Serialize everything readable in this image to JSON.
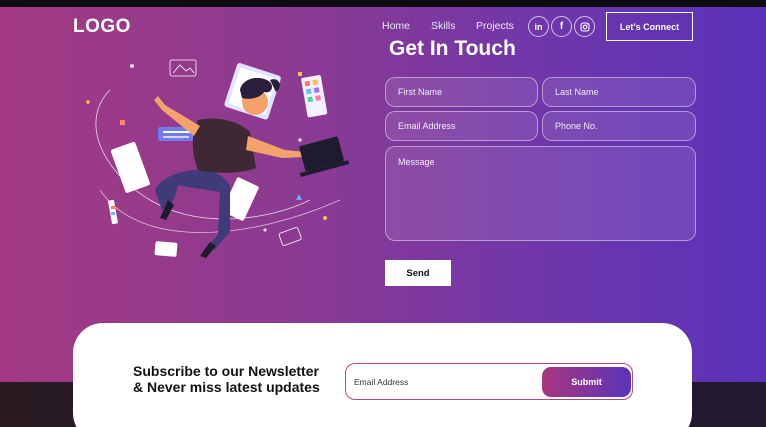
{
  "colors": {
    "hero_gradient_start": "#a33a83",
    "hero_gradient_end": "#5a32b8",
    "white": "#ffffff",
    "submit_gradient_start": "#a8367f",
    "submit_gradient_end": "#5a34b8"
  },
  "header": {
    "logo": "LOGO",
    "nav": [
      {
        "label": "Home"
      },
      {
        "label": "Skills"
      },
      {
        "label": "Projects"
      }
    ],
    "social": [
      {
        "icon": "linkedin-icon",
        "glyph": "in"
      },
      {
        "icon": "facebook-icon",
        "glyph": "f"
      },
      {
        "icon": "instagram-icon",
        "glyph": ""
      }
    ],
    "connect_label": "Let’s Connect"
  },
  "contact": {
    "title": "Get In Touch",
    "first_name_placeholder": "First Name",
    "last_name_placeholder": "Last Name",
    "email_placeholder": "Email Address",
    "phone_placeholder": "Phone No.",
    "message_placeholder": "Message",
    "send_label": "Send"
  },
  "newsletter": {
    "heading_line1": "Subscribe to our Newsletter",
    "heading_line2": "& Never miss latest updates",
    "email_placeholder": "Email Address",
    "submit_label": "Submit"
  }
}
